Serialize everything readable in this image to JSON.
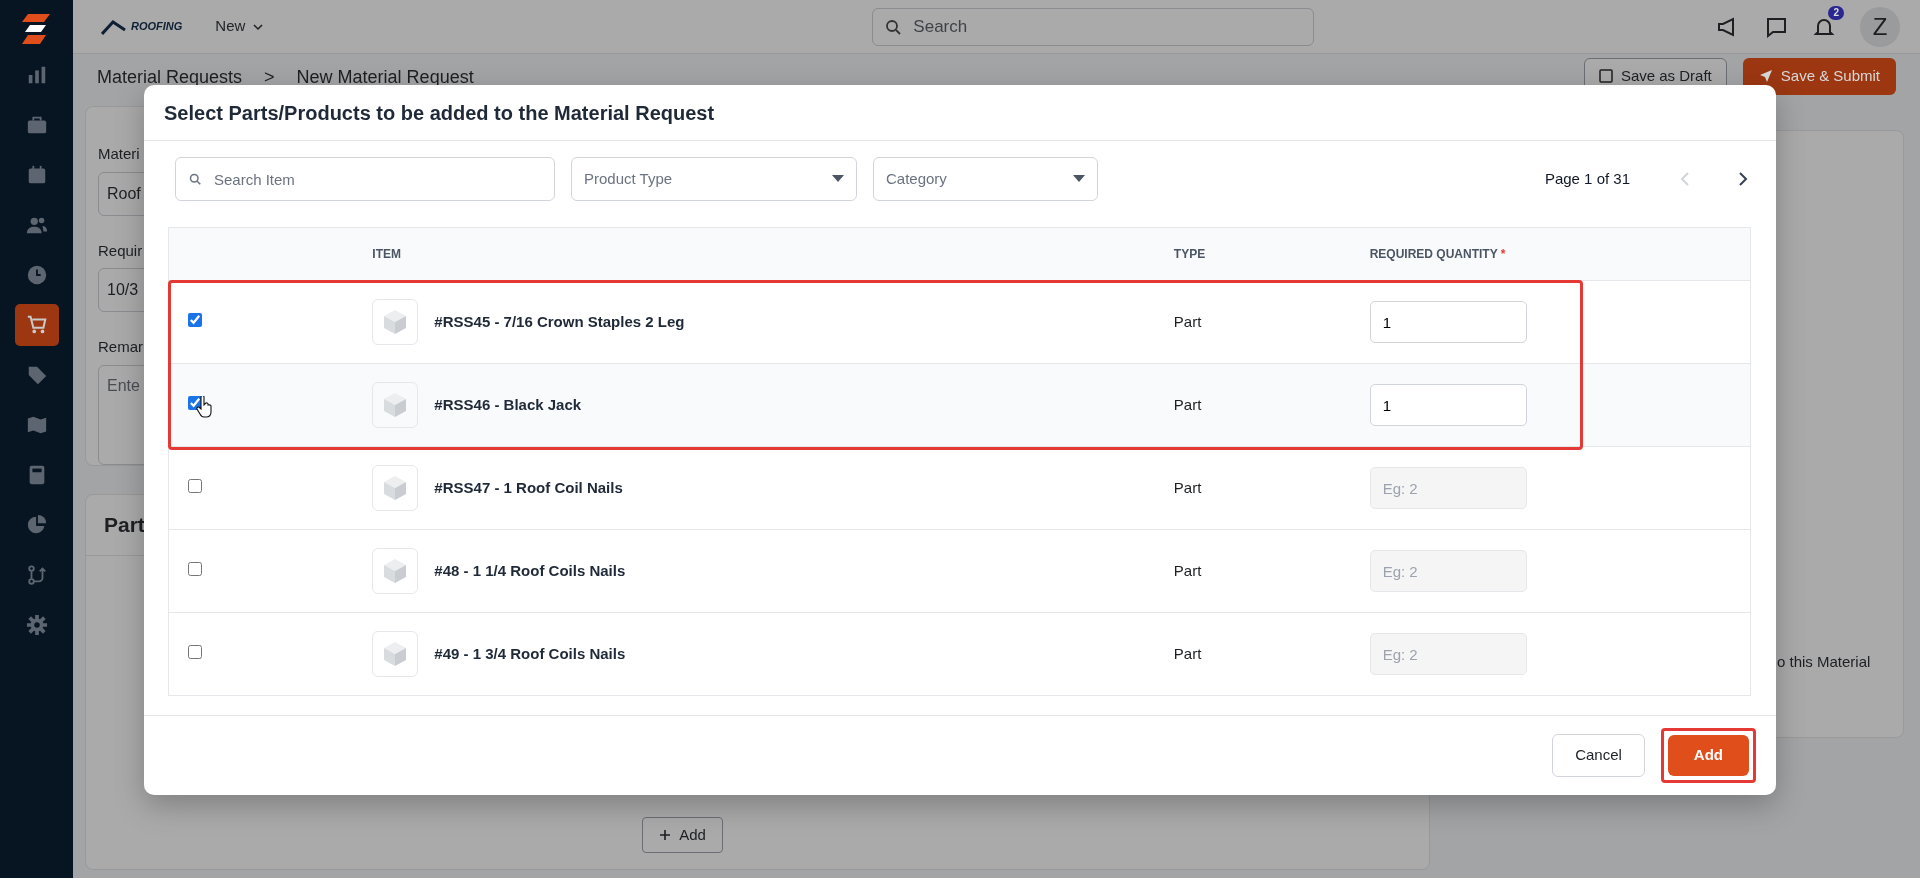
{
  "topbar": {
    "brand": "ROOFING",
    "new_menu": "New",
    "search": {
      "placeholder": "Search"
    },
    "notification_count": "2",
    "avatar": "Z"
  },
  "sidebar": {
    "items": [
      {
        "selected": false
      },
      {
        "selected": false
      },
      {
        "selected": false
      },
      {
        "selected": false
      },
      {
        "selected": false
      },
      {
        "selected": true
      },
      {
        "selected": false
      },
      {
        "selected": false
      },
      {
        "selected": false
      },
      {
        "selected": false
      },
      {
        "selected": false
      },
      {
        "selected": false
      }
    ]
  },
  "breadcrumb": {
    "items": [
      "Material Requests",
      "New Material Request"
    ],
    "separator": ">"
  },
  "header_buttons": {
    "save_draft": "Save as Draft",
    "save_submit": "Save & Submit"
  },
  "form": {
    "fields": [
      {
        "label": "Materi",
        "value": "Roof"
      },
      {
        "label": "Requir",
        "value": "10/3"
      },
      {
        "label": "Remar",
        "placeholder": "Ente"
      }
    ],
    "parts_title": "Part",
    "add_button": "Add"
  },
  "side_panel": {
    "text": "o this Material"
  },
  "modal": {
    "title": "Select Parts/Products to be added to the Material Request",
    "search": {
      "placeholder": "Search Item"
    },
    "filters": [
      {
        "placeholder": "Product Type"
      },
      {
        "placeholder": "Category"
      }
    ],
    "pagination": {
      "label": "Page 1 of 31",
      "prev_disabled": true,
      "next_disabled": false
    },
    "columns": [
      "ITEM",
      "TYPE",
      "REQUIRED QUANTITY"
    ],
    "required_mark": "*",
    "rows": [
      {
        "name": "#RSS45 - 7/16 Crown Staples 2 Leg",
        "type": "Part",
        "checked": true,
        "hovered": false,
        "highlighted": true,
        "quantity": "1"
      },
      {
        "name": "#RSS46 - Black Jack",
        "type": "Part",
        "checked": true,
        "hovered": true,
        "highlighted": true,
        "quantity": "1"
      },
      {
        "name": "#RSS47 - 1 Roof Coil Nails",
        "type": "Part",
        "checked": false,
        "hovered": false,
        "highlighted": false,
        "placeholder": "Eg: 2"
      },
      {
        "name": "#48 - 1 1/4 Roof Coils Nails",
        "type": "Part",
        "checked": false,
        "hovered": false,
        "highlighted": false,
        "placeholder": "Eg: 2"
      },
      {
        "name": "#49 - 1 3/4 Roof Coils Nails",
        "type": "Part",
        "checked": false,
        "hovered": false,
        "highlighted": false,
        "placeholder": "Eg: 2"
      }
    ],
    "cancel_button": "Cancel",
    "add_button": {
      "label": "Add",
      "highlighted": true
    }
  }
}
